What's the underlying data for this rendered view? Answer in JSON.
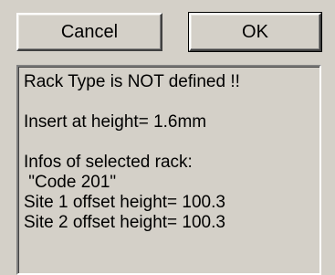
{
  "buttons": {
    "cancel_label": "Cancel",
    "ok_label": "OK"
  },
  "info": {
    "not_defined": "Rack Type is NOT defined !!",
    "insert_height": "Insert at height= 1.6mm",
    "selected_header": "Infos of selected rack:",
    "code": " \"Code 201\"",
    "site1": "Site 1 offset height= 100.3",
    "site2": "Site 2 offset height= 100.3"
  }
}
